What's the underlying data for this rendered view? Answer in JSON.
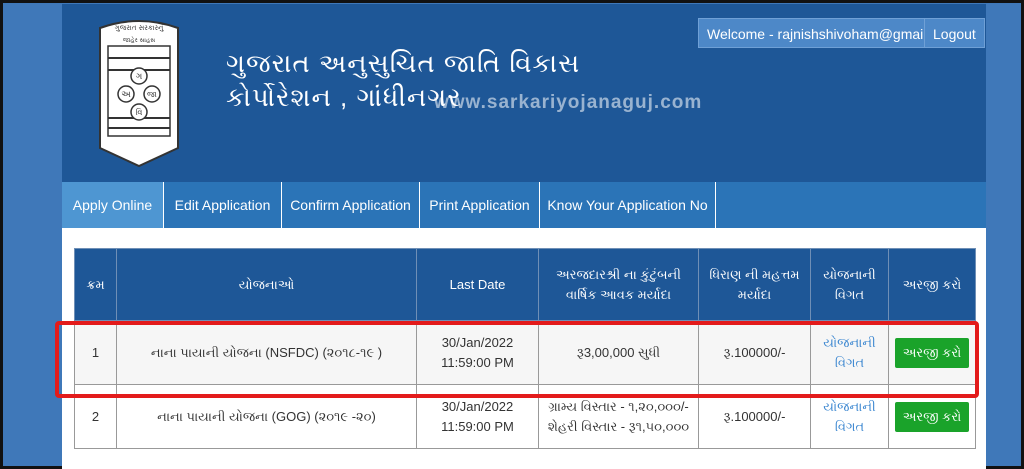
{
  "header": {
    "org_title_line1": "ગુજરાત અનુસુચિત જાતિ વિકાસ",
    "org_title_line2": "કોર્પોરેશન , ગાંધીનગર",
    "watermark": "www.sarkariyojanaguj.com",
    "welcome_label": "Welcome - rajnishshivoham@gmail.com",
    "logout_label": "Logout",
    "logo": {
      "top_text": "ગુજરાત સરકારનું",
      "sub_text": "જાહેર સાહસ",
      "letters": [
        "ગ",
        "અ",
        "જા",
        "વિ"
      ]
    }
  },
  "nav": {
    "items": [
      {
        "label": "Apply Online"
      },
      {
        "label": "Edit Application"
      },
      {
        "label": "Confirm Application"
      },
      {
        "label": "Print Application"
      },
      {
        "label": "Know Your Application No"
      }
    ]
  },
  "table": {
    "headers": [
      "ક્રમ",
      "યોજનાઓ",
      "Last Date",
      "અરજદારશ્રી ના કુંટુંબની વાર્ષિક આવક મર્યાદા",
      "ધિરાણ ની મહત્તમ મર્યાદા",
      "યોજનાની વિગત",
      "અરજી કરો"
    ],
    "rows": [
      {
        "sr": "1",
        "scheme": "નાના પાયાની યોજના (NSFDC) (૨૦૧૮-૧૯ )",
        "date": "30/Jan/2022",
        "time": "11:59:00 PM",
        "income": "રૂ3,00,000 સુધી",
        "income2": "",
        "loan": "રૂ.100000/-",
        "details": "યોજનાની વિગત",
        "apply": "અરજી કરો"
      },
      {
        "sr": "2",
        "scheme": "નાના પાયાની યોજના (GOG) (૨૦૧૯ -૨૦)",
        "date": "30/Jan/2022",
        "time": "11:59:00 PM",
        "income": "ગ્રામ્ય વિસ્તાર - ૧,૨૦,૦૦૦/-",
        "income2": "શેહરી વિસ્તાર - રૂ૧,૫૦,૦૦૦",
        "loan": "રૂ.100000/-",
        "details": "યોજનાની વિગત",
        "apply": "અરજી કરો"
      }
    ]
  },
  "colors": {
    "header_bg": "#1e5797",
    "nav_bg": "#2b74b7",
    "apply_button": "#1aa32a",
    "highlight": "#e31b1b"
  }
}
